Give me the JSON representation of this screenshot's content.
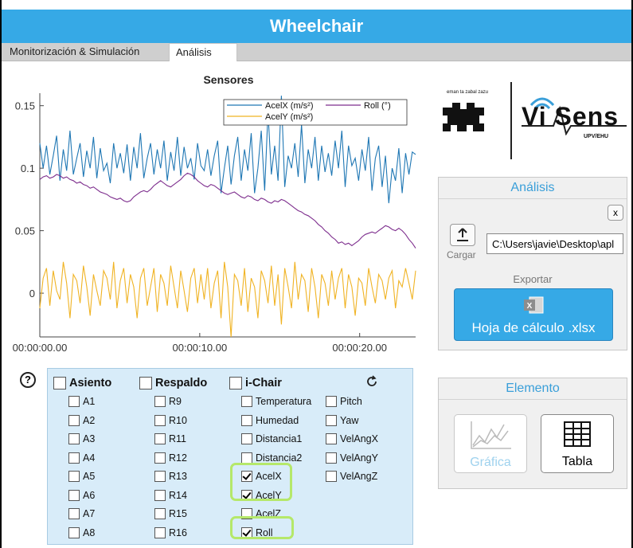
{
  "app": {
    "title": "Wheelchair"
  },
  "tabs": [
    {
      "label": "Monitorización & Simulación",
      "active": false
    },
    {
      "label": "Análisis",
      "active": true
    }
  ],
  "chart_data": {
    "type": "line",
    "title": "Sensores",
    "xlabel": "",
    "ylabel": "",
    "ylim": [
      -0.035,
      0.16
    ],
    "xlim": [
      0,
      23.5
    ],
    "x_tick_labels": [
      "00:00:00.00",
      "00:00:10.00",
      "00:00:20.00"
    ],
    "y_tick_labels": [
      "0",
      "0.05",
      "0.1",
      "0.15"
    ],
    "legend": {
      "placement": "top-right",
      "labels": [
        "AcelX  (m/s²)",
        "AcelY  (m/s²)",
        "Roll (°)"
      ]
    },
    "series": [
      {
        "name": "AcelX  (m/s²)",
        "color": "#1f77b4",
        "values": [
          0.12,
          0.1,
          0.118,
          0.095,
          0.11,
          0.126,
          0.09,
          0.115,
          0.098,
          0.13,
          0.095,
          0.108,
          0.12,
          0.093,
          0.114,
          0.1,
          0.125,
          0.092,
          0.116,
          0.098,
          0.104,
          0.088,
          0.12,
          0.1,
          0.112,
          0.096,
          0.119,
          0.09,
          0.117,
          0.1,
          0.128,
          0.092,
          0.108,
          0.12,
          0.095,
          0.115,
          0.1,
          0.122,
          0.09,
          0.113,
          0.098,
          0.125,
          0.094,
          0.117,
          0.1,
          0.108,
          0.091,
          0.12,
          0.102,
          0.098,
          0.115,
          0.094,
          0.11,
          0.122,
          0.08,
          0.1,
          0.118,
          0.087,
          0.11,
          0.125,
          0.09,
          0.115,
          0.098,
          0.128,
          0.08,
          0.1,
          0.13,
          0.082,
          0.145,
          0.095,
          0.118,
          0.09,
          0.158,
          0.085,
          0.11,
          0.1,
          0.12,
          0.093,
          0.135,
          0.088,
          0.115,
          0.1,
          0.125,
          0.09,
          0.118,
          0.097,
          0.112,
          0.094,
          0.122,
          0.1,
          0.13,
          0.085,
          0.118,
          0.102,
          0.108,
          0.09,
          0.115,
          0.098,
          0.125,
          0.082,
          0.108,
          0.118,
          0.085,
          0.11,
          0.072,
          0.1,
          0.09,
          0.116,
          0.08,
          0.112,
          0.095,
          0.113,
          0.111
        ]
      },
      {
        "name": "AcelY  (m/s²)",
        "color": "#f0b323",
        "values": [
          -0.012,
          0.012,
          0.02,
          -0.01,
          0.018,
          0.002,
          -0.005,
          0.025,
          0.008,
          -0.02,
          0.015,
          0.01,
          -0.008,
          0.022,
          0.005,
          -0.018,
          0.015,
          0.002,
          -0.01,
          0.018,
          0.012,
          -0.005,
          0.025,
          -0.012,
          0.01,
          0.02,
          -0.008,
          0.015,
          0.005,
          -0.02,
          0.012,
          0.02,
          -0.01,
          0.005,
          0.02,
          -0.015,
          0.015,
          0.008,
          -0.01,
          0.022,
          0.005,
          -0.012,
          0.018,
          0.002,
          -0.015,
          0.012,
          0.02,
          -0.008,
          0.015,
          -0.005,
          0.02,
          -0.012,
          0.008,
          0.018,
          -0.02,
          0.025,
          0.005,
          -0.035,
          0.015,
          0.01,
          -0.01,
          0.02,
          -0.015,
          0.012,
          0.005,
          -0.02,
          0.018,
          0.01,
          -0.008,
          0.022,
          -0.01,
          0.015,
          -0.025,
          0.02,
          0.005,
          -0.012,
          0.025,
          -0.005,
          0.015,
          0.01,
          -0.015,
          0.02,
          0.005,
          -0.02,
          0.015,
          0.008,
          -0.01,
          0.018,
          -0.005,
          0.012,
          0.02,
          -0.012,
          0.015,
          0.005,
          -0.018,
          0.012,
          0.008,
          -0.01,
          0.02,
          0.005,
          -0.008,
          0.015,
          0.01,
          -0.005,
          0.012,
          0.018,
          -0.012,
          0.01,
          0.005,
          0.02,
          0.008,
          -0.005,
          0.018
        ]
      },
      {
        "name": "Roll (°)",
        "color": "#7e2f8e",
        "values": [
          0.091,
          0.093,
          0.094,
          0.092,
          0.093,
          0.095,
          0.094,
          0.092,
          0.093,
          0.091,
          0.09,
          0.088,
          0.089,
          0.087,
          0.086,
          0.084,
          0.085,
          0.083,
          0.081,
          0.08,
          0.079,
          0.077,
          0.076,
          0.075,
          0.076,
          0.074,
          0.073,
          0.074,
          0.077,
          0.079,
          0.081,
          0.082,
          0.081,
          0.083,
          0.086,
          0.088,
          0.09,
          0.088,
          0.086,
          0.085,
          0.087,
          0.089,
          0.091,
          0.094,
          0.096,
          0.095,
          0.093,
          0.09,
          0.088,
          0.086,
          0.085,
          0.087,
          0.086,
          0.084,
          0.082,
          0.08,
          0.079,
          0.08,
          0.081,
          0.079,
          0.077,
          0.076,
          0.078,
          0.077,
          0.075,
          0.074,
          0.076,
          0.075,
          0.073,
          0.072,
          0.074,
          0.073,
          0.075,
          0.074,
          0.072,
          0.07,
          0.068,
          0.066,
          0.065,
          0.063,
          0.062,
          0.06,
          0.058,
          0.055,
          0.053,
          0.05,
          0.048,
          0.045,
          0.043,
          0.04,
          0.041,
          0.039,
          0.04,
          0.038,
          0.04,
          0.042,
          0.045,
          0.047,
          0.048,
          0.049,
          0.048,
          0.05,
          0.052,
          0.054,
          0.053,
          0.051,
          0.05,
          0.052,
          0.05,
          0.047,
          0.043,
          0.04,
          0.036
        ]
      }
    ]
  },
  "logos": {
    "ehu_text": "eman ta zabal zazu",
    "visens_text": "Vi Sens",
    "visens_sub": "UPV/EHU"
  },
  "analisis": {
    "title": "Análisis",
    "close_label": "x",
    "cargar_label": "Cargar",
    "path_value": "C:\\Users\\javie\\Desktop\\apl",
    "exportar_label": "Exportar",
    "excel_button_label": "Hoja de cálculo .xlsx"
  },
  "elemento": {
    "title": "Elemento",
    "grafica_label": "Gráfica",
    "tabla_label": "Tabla"
  },
  "help_label": "?",
  "selector": {
    "asiento": {
      "label": "Asiento",
      "checked": false,
      "items": [
        "A1",
        "A2",
        "A3",
        "A4",
        "A5",
        "A6",
        "A7",
        "A8"
      ]
    },
    "respaldo": {
      "label": "Respaldo",
      "checked": false,
      "items": [
        "R9",
        "R10",
        "R11",
        "R12",
        "R13",
        "R14",
        "R15",
        "R16"
      ]
    },
    "ichair": {
      "label": "i-Chair",
      "checked": false,
      "col1": [
        {
          "label": "Temperatura",
          "checked": false
        },
        {
          "label": "Humedad",
          "checked": false
        },
        {
          "label": "Distancia1",
          "checked": false
        },
        {
          "label": "Distancia2",
          "checked": false
        },
        {
          "label": "AcelX",
          "checked": true
        },
        {
          "label": "AcelY",
          "checked": true
        },
        {
          "label": "AcelZ",
          "checked": false
        },
        {
          "label": "Roll",
          "checked": true
        }
      ],
      "col2": [
        {
          "label": "Pitch",
          "checked": false
        },
        {
          "label": "Yaw",
          "checked": false
        },
        {
          "label": "VelAngX",
          "checked": false
        },
        {
          "label": "VelAngY",
          "checked": false
        },
        {
          "label": "VelAngZ",
          "checked": false
        }
      ]
    },
    "refresh_icon": "refresh-icon"
  }
}
